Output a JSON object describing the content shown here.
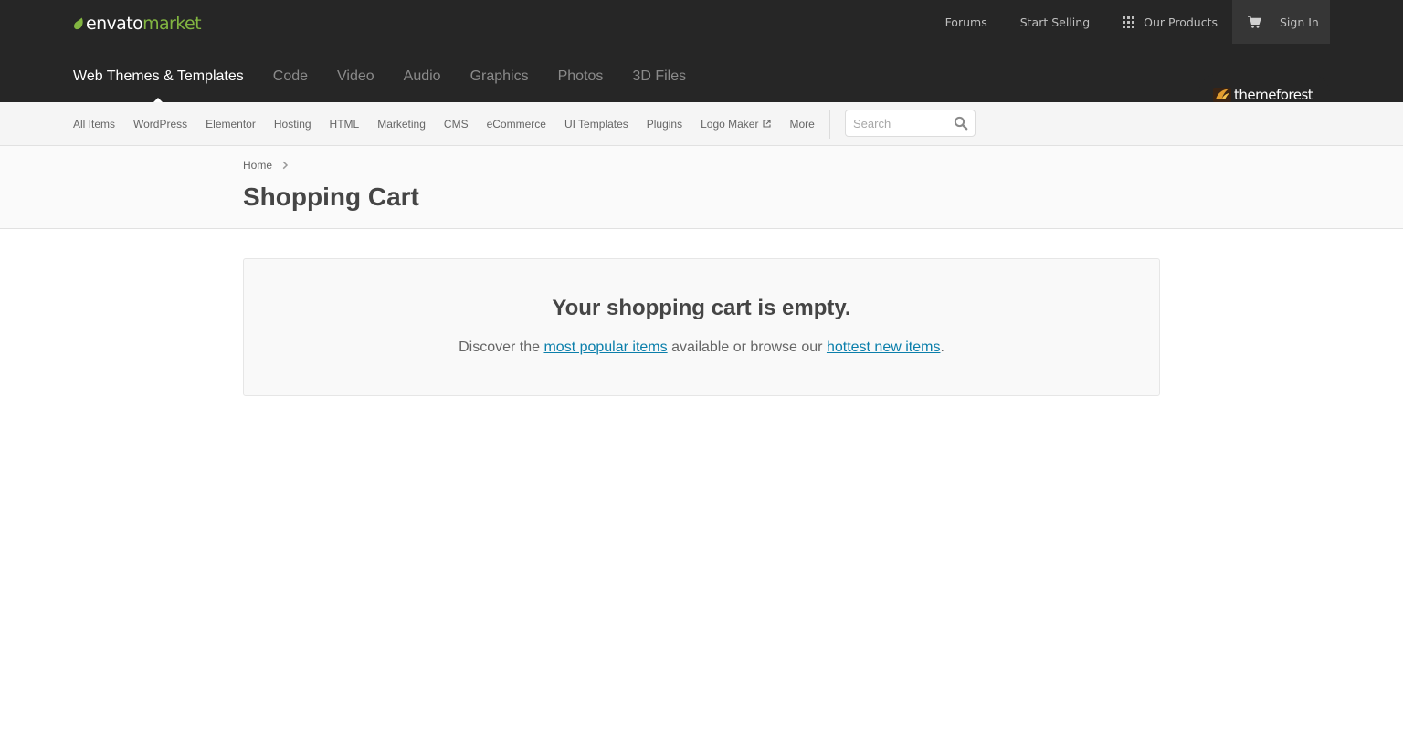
{
  "header": {
    "logo": {
      "word1": "envato",
      "word2": "market"
    },
    "top_links": {
      "forums": "Forums",
      "start_selling": "Start Selling",
      "our_products": "Our Products",
      "sign_in": "Sign In"
    },
    "categories": [
      {
        "label": "Web Themes & Templates",
        "active": true
      },
      {
        "label": "Code"
      },
      {
        "label": "Video"
      },
      {
        "label": "Audio"
      },
      {
        "label": "Graphics"
      },
      {
        "label": "Photos"
      },
      {
        "label": "3D Files"
      }
    ],
    "badge": {
      "label": "themeforest"
    }
  },
  "subnav": {
    "items": [
      "All Items",
      "WordPress",
      "Elementor",
      "Hosting",
      "HTML",
      "Marketing",
      "CMS",
      "eCommerce",
      "UI Templates",
      "Plugins",
      "Logo Maker",
      "More"
    ],
    "search": {
      "placeholder": "Search",
      "value": ""
    }
  },
  "breadcrumb": {
    "home": "Home"
  },
  "page": {
    "title": "Shopping Cart"
  },
  "cart": {
    "empty_title": "Your shopping cart is empty.",
    "text_before": "Discover the ",
    "link_popular": "most popular items",
    "text_middle": " available or browse our ",
    "link_hottest": "hottest new items",
    "text_after": "."
  },
  "colors": {
    "header_bg": "#262626",
    "accent_green": "#82b541",
    "link_blue": "#0b7fab",
    "title_text": "#454545"
  },
  "icons": [
    "envato-leaf-icon",
    "grid-icon",
    "cart-icon",
    "themeforest-icon",
    "external-link-icon",
    "search-icon",
    "chevron-right-icon"
  ]
}
